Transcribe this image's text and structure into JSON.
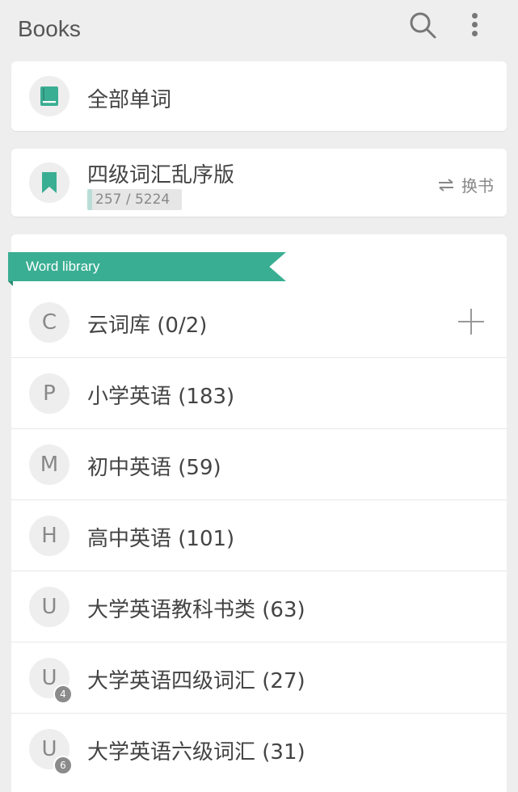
{
  "header": {
    "title": "Books",
    "icons": [
      "search-icon",
      "more-vert-icon"
    ]
  },
  "all_words": {
    "label": "全部单词",
    "icon": "book-icon"
  },
  "current_book": {
    "label": "四级词汇乱序版",
    "icon": "bookmark-icon",
    "progress_text": "257 / 5224",
    "progress_fraction": 0.049,
    "switch_label": "换书",
    "switch_icon": "swap-icon"
  },
  "library": {
    "ribbon_label": "Word library",
    "accent_color": "#3aae93",
    "items": [
      {
        "letter": "C",
        "label": "云词库 (0/2)",
        "badge": ""
      },
      {
        "letter": "P",
        "label": "小学英语 (183)",
        "badge": ""
      },
      {
        "letter": "M",
        "label": "初中英语 (59)",
        "badge": ""
      },
      {
        "letter": "H",
        "label": "高中英语 (101)",
        "badge": ""
      },
      {
        "letter": "U",
        "label": "大学英语教科书类 (63)",
        "badge": ""
      },
      {
        "letter": "U",
        "label": "大学英语四级词汇 (27)",
        "badge": "4"
      },
      {
        "letter": "U",
        "label": "大学英语六级词汇 (31)",
        "badge": "6"
      }
    ]
  }
}
